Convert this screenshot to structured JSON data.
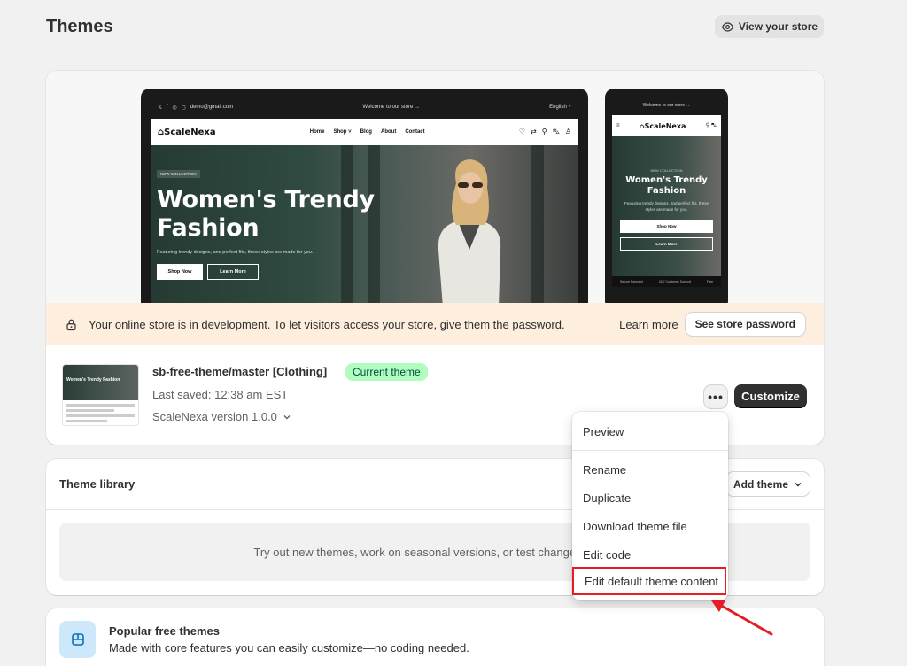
{
  "page": {
    "title": "Themes",
    "view_store_label": "View your store"
  },
  "preview": {
    "desktop": {
      "email": "demo@gmail.com",
      "welcome": "Welcome to our store",
      "language": "English",
      "logo": "ScaleNexa",
      "menu": [
        "Home",
        "Shop",
        "Blog",
        "About",
        "Contact"
      ],
      "tag": "NEW COLLECTION",
      "title_line1": "Women's Trendy",
      "title_line2": "Fashion",
      "subtitle": "Featuring trendy designs, and perfect fits, these styles are made for you.",
      "btn_shop": "Shop Now",
      "btn_learn": "Learn More"
    },
    "mobile": {
      "welcome": "Welcome to our store",
      "logo": "ScaleNexa",
      "tag": "NEW COLLECTION",
      "title_line1": "Women's Trendy",
      "title_line2": "Fashion",
      "subtitle": "Featuring trendy designs, and perfect fits, these styles are made for you.",
      "btn_shop": "Shop Now",
      "btn_learn": "Learn More",
      "footer_left": "Secure Payment",
      "footer_mid": "24/7 Customer Support",
      "footer_right": "Free"
    }
  },
  "banner": {
    "message": "Your online store is in development. To let visitors access your store, give them the password.",
    "learn_more": "Learn more",
    "see_password": "See store password"
  },
  "current_theme": {
    "name": "sb-free-theme/master [Clothing]",
    "badge": "Current theme",
    "last_saved": "Last saved: 12:38 am EST",
    "version": "ScaleNexa version 1.0.0",
    "dots": "•••",
    "customize": "Customize",
    "thumb_title": "Women's Trendy Fashion"
  },
  "menu": {
    "items": [
      "Preview",
      "Rename",
      "Duplicate",
      "Download theme file",
      "Edit code",
      "Edit default theme content"
    ]
  },
  "library": {
    "title": "Theme library",
    "add_theme": "Add theme",
    "empty_text": "Try out new themes, work on seasonal versions, or test changes to you"
  },
  "popular": {
    "title": "Popular free themes",
    "subtitle": "Made with core features you can easily customize—no coding needed."
  },
  "colors": {
    "accent": "#303030",
    "badge_bg": "#affebf",
    "banner_bg": "#fdeede",
    "highlight": "#e41e26"
  }
}
